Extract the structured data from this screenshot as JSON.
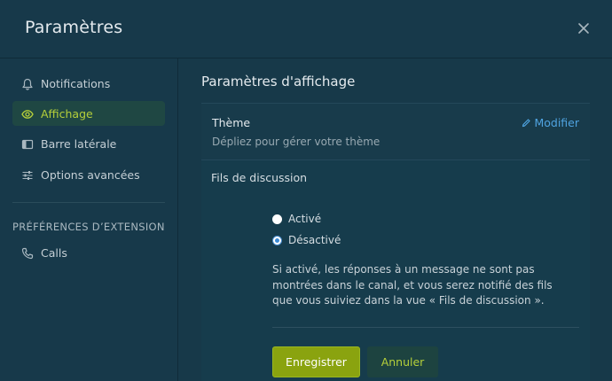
{
  "dialog": {
    "title": "Paramètres",
    "close_icon": "close-icon"
  },
  "sidebar": {
    "items": [
      {
        "label": "Notifications",
        "icon": "bell-icon",
        "active": false
      },
      {
        "label": "Affichage",
        "icon": "eye-icon",
        "active": true
      },
      {
        "label": "Barre latérale",
        "icon": "sidebar-icon",
        "active": false
      },
      {
        "label": "Options avancées",
        "icon": "sliders-icon",
        "active": false
      }
    ],
    "section_heading": "PRÉFÉRENCES D’EXTENSION",
    "extension_items": [
      {
        "label": "Calls",
        "icon": "phone-icon"
      }
    ]
  },
  "main": {
    "title": "Paramètres d'affichage",
    "theme": {
      "label": "Thème",
      "description": "Dépliez pour gérer votre thème",
      "edit_label": "Modifier"
    },
    "threads": {
      "label": "Fils de discussion",
      "options": [
        {
          "label": "Activé",
          "checked": false
        },
        {
          "label": "Désactivé",
          "checked": true
        }
      ],
      "help": "Si activé, les réponses à un message ne sont pas montrées dans le canal, et vous serez notifié des fils que vous suiviez dans la vue « Fils de discussion ».",
      "save_label": "Enregistrer",
      "cancel_label": "Annuler"
    }
  },
  "colors": {
    "accent": "#b5cf3a",
    "primary_button": "#8aa30f",
    "link": "#4fa3e0",
    "background": "#17394a"
  }
}
